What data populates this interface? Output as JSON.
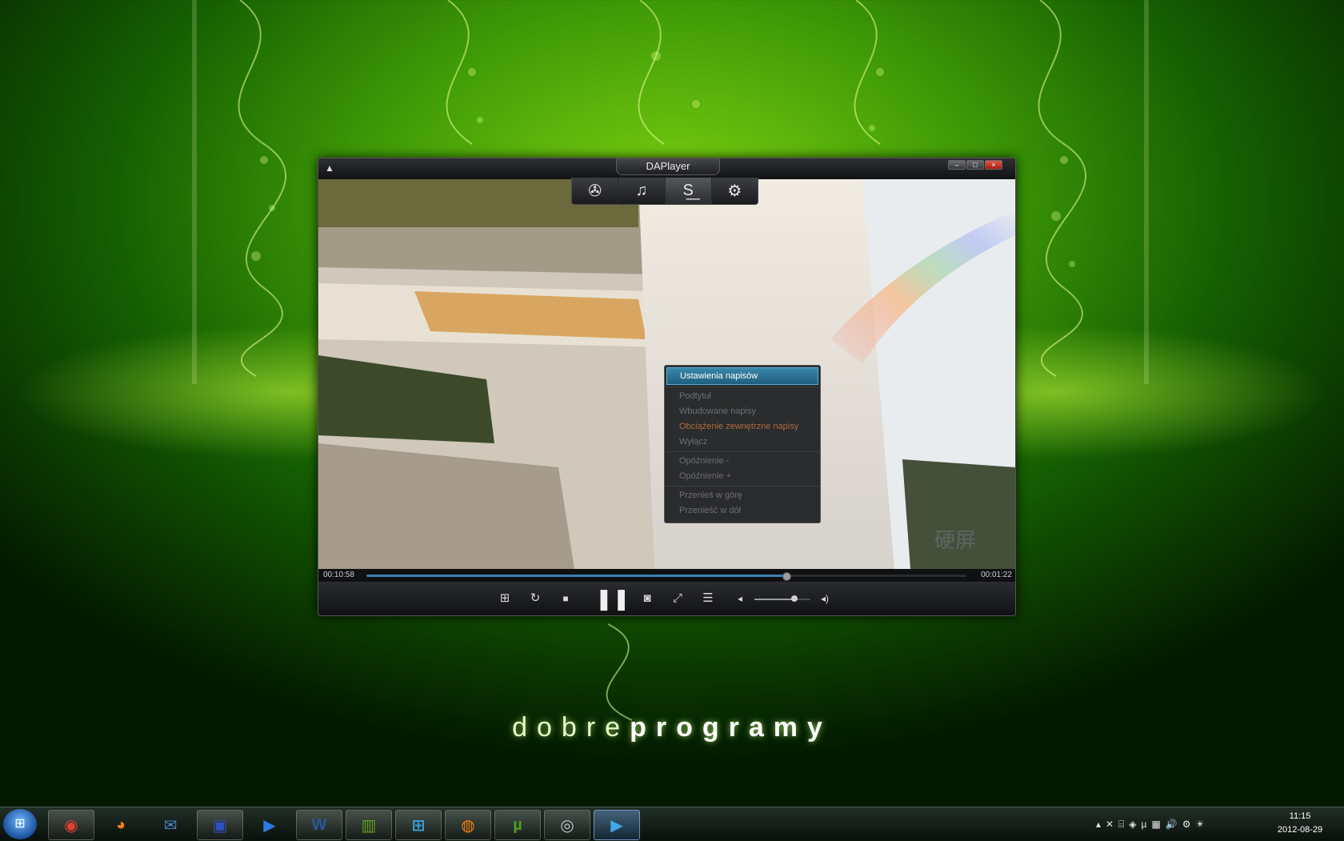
{
  "desktop": {
    "wordmark_light": "dobre",
    "wordmark_bold": "programy"
  },
  "player": {
    "title": "DAPlayer",
    "app_icon": "shirt-icon",
    "window_buttons": {
      "minimize": "–",
      "maximize": "□",
      "close": "×"
    },
    "toolbar_tabs": [
      {
        "icon": "film-reel-icon",
        "glyph": "✇"
      },
      {
        "icon": "music-notes-icon",
        "glyph": "♫"
      },
      {
        "icon": "subtitles-icon",
        "glyph": "S͟"
      },
      {
        "icon": "disc-settings-icon",
        "glyph": "⚙"
      }
    ],
    "subtitle_menu": {
      "items": [
        {
          "label": "Ustawienia napisów",
          "state": "selected"
        },
        {
          "label": "Podtytuł",
          "state": "disabled"
        },
        {
          "label": "Wbudowane napisy",
          "state": "disabled"
        },
        {
          "label": "Obciążenie zewnętrzne napisy",
          "state": "accent"
        },
        {
          "label": "Wyłącz",
          "state": "disabled"
        },
        {
          "label": "Opóźnienie -",
          "state": "disabled"
        },
        {
          "label": "Opóźnienie +",
          "state": "disabled"
        },
        {
          "label": "Przenieś w górę",
          "state": "disabled"
        },
        {
          "label": "Przenieść w dół",
          "state": "disabled"
        }
      ]
    },
    "elapsed_time": "00:10:58",
    "remaining_time": "00:01:22",
    "progress": 0.7,
    "volume": 0.72,
    "controls": [
      {
        "icon": "open-file-icon",
        "glyph": "⊞"
      },
      {
        "icon": "repeat-icon",
        "glyph": "↻"
      },
      {
        "icon": "stop-icon",
        "glyph": "■"
      },
      {
        "icon": "pause-icon",
        "glyph": "❚❚"
      },
      {
        "icon": "camera-icon",
        "glyph": "◙"
      },
      {
        "icon": "fullscreen-icon",
        "glyph": "⤢"
      },
      {
        "icon": "playlist-icon",
        "glyph": "☰"
      },
      {
        "icon": "volume-low-icon",
        "glyph": "◂"
      },
      {
        "icon": "volume-high-icon",
        "glyph": "◂)"
      }
    ],
    "video_watermark": "硬屏"
  },
  "taskbar": {
    "apps": [
      {
        "icon": "chrome-icon",
        "glyph": "◉",
        "color": "#e04030"
      },
      {
        "icon": "firefox-icon",
        "glyph": "◕",
        "color": "#f08020"
      },
      {
        "icon": "thunderbird-icon",
        "glyph": "✉",
        "color": "#4a80c0"
      },
      {
        "icon": "floppy-disk-icon",
        "glyph": "▣",
        "color": "#3050c0"
      },
      {
        "icon": "media-player-icon",
        "glyph": "▶",
        "color": "#2a7ae0"
      },
      {
        "icon": "word-icon",
        "glyph": "W",
        "color": "#2b579a"
      },
      {
        "icon": "film-strip-icon",
        "glyph": "▥",
        "color": "#60a020"
      },
      {
        "icon": "windows-icon",
        "glyph": "⊞",
        "color": "#3aa0e0"
      },
      {
        "icon": "office-icon",
        "glyph": "◍",
        "color": "#f08010"
      },
      {
        "icon": "utorrent-icon",
        "glyph": "µ",
        "color": "#4aa020"
      },
      {
        "icon": "steam-icon",
        "glyph": "◎",
        "color": "#c0c8d0"
      },
      {
        "icon": "daplayer-icon",
        "glyph": "▶",
        "color": "#40a8e8"
      }
    ],
    "tray_icons": [
      "▴",
      "✕",
      "⌸",
      "◈",
      "µ",
      "▦",
      "🔊",
      "⚙",
      "☀"
    ],
    "clock_time": "11:15",
    "clock_date": "2012-08-29"
  }
}
